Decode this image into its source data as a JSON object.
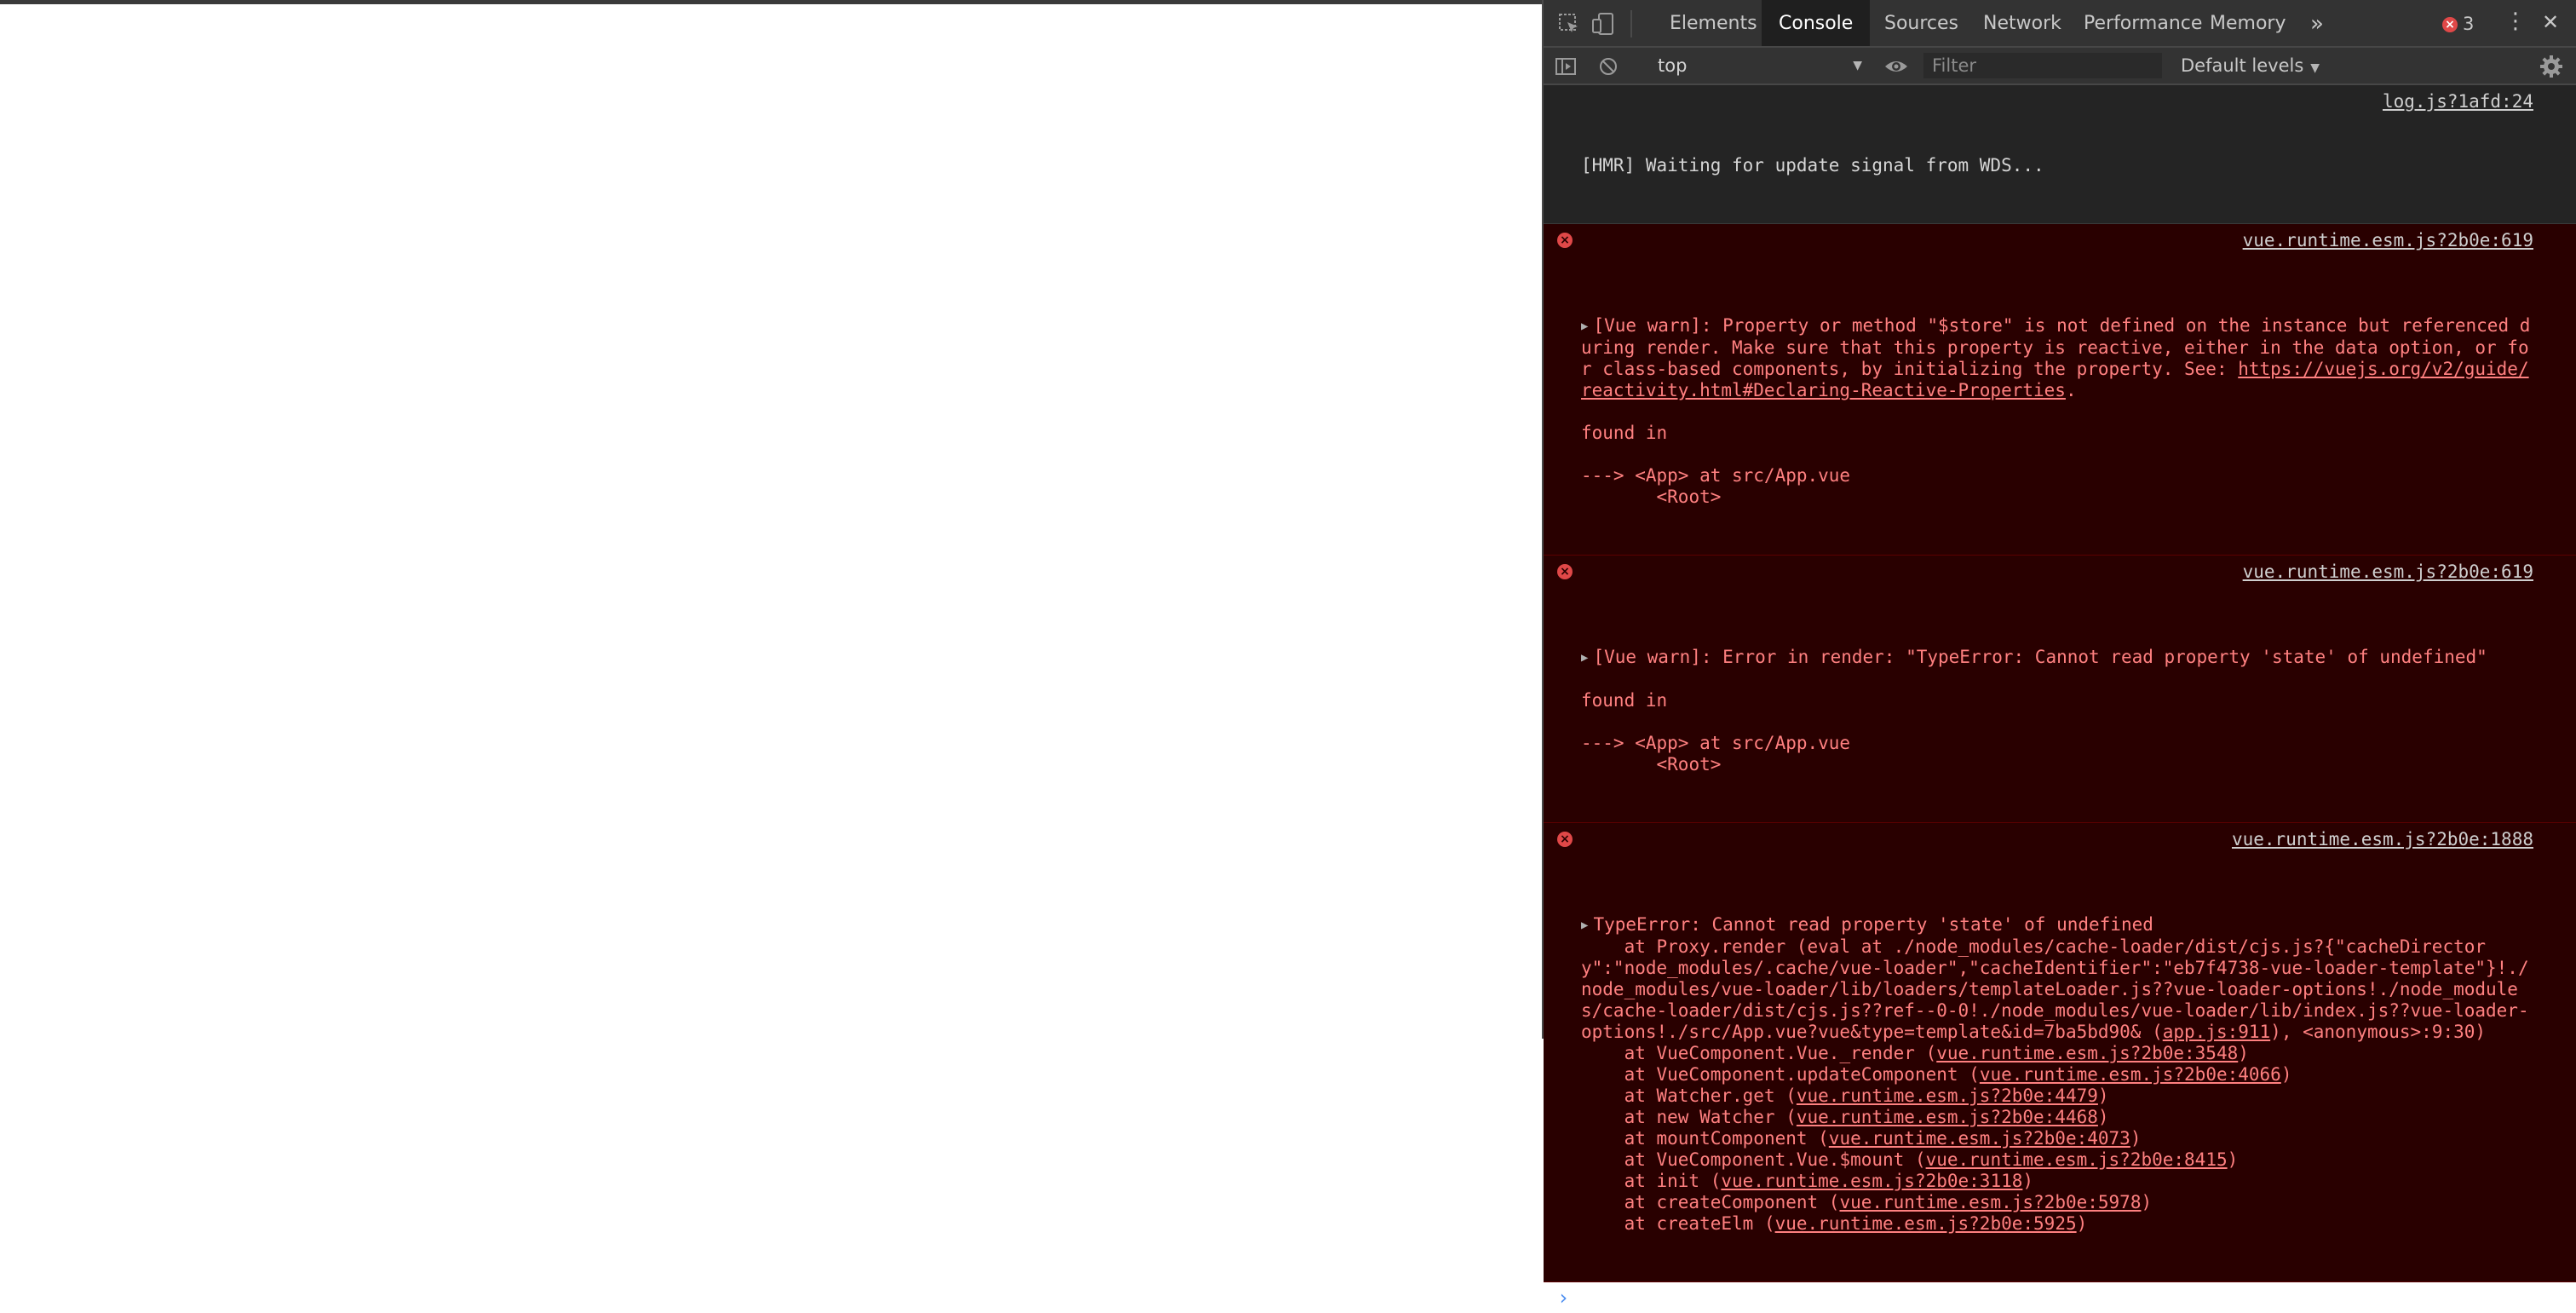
{
  "devtools": {
    "tabs": [
      {
        "label": "Elements"
      },
      {
        "label": "Console"
      },
      {
        "label": "Sources"
      },
      {
        "label": "Network"
      },
      {
        "label": "Performance"
      },
      {
        "label": "Memory"
      }
    ],
    "more_tabs_glyph": "»",
    "error_count": "3",
    "menu_glyph": "⋮",
    "close_glyph": "✕"
  },
  "toolbar": {
    "context": "top",
    "filter_placeholder": "Filter",
    "levels": "Default levels"
  },
  "console": {
    "log": {
      "text": "[HMR] Waiting for update signal from WDS...",
      "source": "log.js?1afd:24"
    },
    "warn1": {
      "source": "vue.runtime.esm.js?2b0e:619",
      "text_before_link": "[Vue warn]: Property or method \"$store\" is not defined on the instance but referenced during render. Make sure that this property is reactive, either in the data option, or for class-based components, by initializing the property. See: ",
      "link": "https://vuejs.org/v2/guide/reactivity.html#Declaring-Reactive-Properties",
      "text_after_link": ".\n\nfound in\n\n---> <App> at src/App.vue\n       <Root>"
    },
    "warn2": {
      "source": "vue.runtime.esm.js?2b0e:619",
      "text": "[Vue warn]: Error in render: \"TypeError: Cannot read property 'state' of undefined\"\n\nfound in\n\n---> <App> at src/App.vue\n       <Root>"
    },
    "error": {
      "source": "vue.runtime.esm.js?2b0e:1888",
      "text_before_link": "TypeError: Cannot read property 'state' of undefined\n    at Proxy.render (eval at ./node_modules/cache-loader/dist/cjs.js?{\"cacheDirectory\":\"node_modules/.cache/vue-loader\",\"cacheIdentifier\":\"eb7f4738-vue-loader-template\"}!./node_modules/vue-loader/lib/loaders/templateLoader.js??vue-loader-options!./node_modules/cache-loader/dist/cjs.js??ref--0-0!./node_modules/vue-loader/lib/index.js??vue-loader-options!./src/App.vue?vue&type=template&id=7ba5bd90& (",
      "app_link": "app.js:911",
      "after_app": "), <anonymous>:9:30)",
      "stack": [
        {
          "prefix": "    at VueComponent.Vue._render (",
          "link": "vue.runtime.esm.js?2b0e:3548",
          "suffix": ")"
        },
        {
          "prefix": "    at VueComponent.updateComponent (",
          "link": "vue.runtime.esm.js?2b0e:4066",
          "suffix": ")"
        },
        {
          "prefix": "    at Watcher.get (",
          "link": "vue.runtime.esm.js?2b0e:4479",
          "suffix": ")"
        },
        {
          "prefix": "    at new Watcher (",
          "link": "vue.runtime.esm.js?2b0e:4468",
          "suffix": ")"
        },
        {
          "prefix": "    at mountComponent (",
          "link": "vue.runtime.esm.js?2b0e:4073",
          "suffix": ")"
        },
        {
          "prefix": "    at VueComponent.Vue.$mount (",
          "link": "vue.runtime.esm.js?2b0e:8415",
          "suffix": ")"
        },
        {
          "prefix": "    at init (",
          "link": "vue.runtime.esm.js?2b0e:3118",
          "suffix": ")"
        },
        {
          "prefix": "    at createComponent (",
          "link": "vue.runtime.esm.js?2b0e:5978",
          "suffix": ")"
        },
        {
          "prefix": "    at createElm (",
          "link": "vue.runtime.esm.js?2b0e:5925",
          "suffix": ")"
        }
      ]
    },
    "prompt_glyph": "›"
  }
}
